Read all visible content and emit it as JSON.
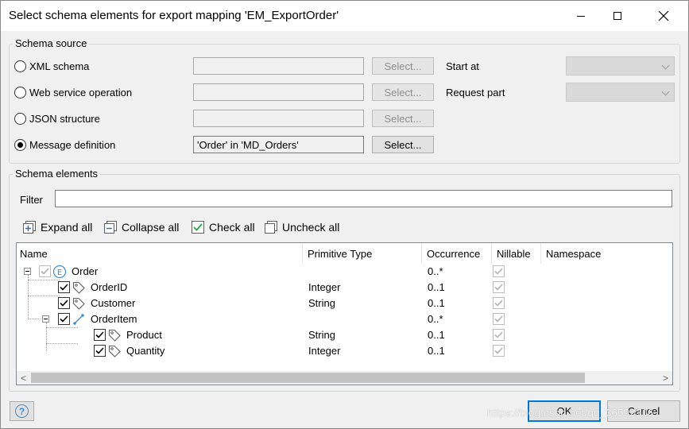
{
  "window": {
    "title": "Select schema elements for export mapping 'EM_ExportOrder'"
  },
  "schema_source": {
    "legend": "Schema source",
    "options": [
      {
        "label": "XML schema",
        "checked": false,
        "value": "",
        "button": "Select...",
        "button_enabled": false
      },
      {
        "label": "Web service operation",
        "checked": false,
        "value": "",
        "button": "Select...",
        "button_enabled": false
      },
      {
        "label": "JSON structure",
        "checked": false,
        "value": "",
        "button": "Select...",
        "button_enabled": false
      },
      {
        "label": "Message definition",
        "checked": true,
        "value": "'Order' in 'MD_Orders'",
        "button": "Select...",
        "button_enabled": true
      }
    ],
    "start_at_label": "Start at",
    "request_part_label": "Request part"
  },
  "schema_elements": {
    "legend": "Schema elements",
    "filter_label": "Filter",
    "filter_value": "",
    "toolbar": {
      "expand_all": "Expand all",
      "collapse_all": "Collapse all",
      "check_all": "Check all",
      "uncheck_all": "Uncheck all"
    },
    "columns": [
      "Name",
      "Primitive Type",
      "Occurrence",
      "Nillable",
      "Namespace"
    ],
    "rows": [
      {
        "name": "Order",
        "type": "",
        "occurrence": "0..*",
        "nillable": true,
        "level": 0,
        "icon": "element-icon",
        "expandable": true,
        "checked": true,
        "disabled": true
      },
      {
        "name": "OrderID",
        "type": "Integer",
        "occurrence": "0..1",
        "nillable": true,
        "level": 1,
        "icon": "attribute-tag-icon",
        "expandable": false,
        "checked": true,
        "disabled": false
      },
      {
        "name": "Customer",
        "type": "String",
        "occurrence": "0..1",
        "nillable": true,
        "level": 1,
        "icon": "attribute-tag-icon",
        "expandable": false,
        "checked": true,
        "disabled": false
      },
      {
        "name": "OrderItem",
        "type": "",
        "occurrence": "0..*",
        "nillable": true,
        "level": 1,
        "icon": "association-icon",
        "expandable": true,
        "checked": true,
        "disabled": false
      },
      {
        "name": "Product",
        "type": "String",
        "occurrence": "0..1",
        "nillable": true,
        "level": 2,
        "icon": "attribute-tag-icon",
        "expandable": false,
        "checked": true,
        "disabled": false
      },
      {
        "name": "Quantity",
        "type": "Integer",
        "occurrence": "0..1",
        "nillable": true,
        "level": 2,
        "icon": "attribute-tag-icon",
        "expandable": false,
        "checked": true,
        "disabled": false
      }
    ]
  },
  "buttons": {
    "ok": "OK",
    "cancel": "Cancel",
    "help": "?"
  },
  "watermark": "https://blog.csdn.net/qq_36592316",
  "colors": {
    "accent": "#0078d7",
    "element_icon": "#3a8fd6",
    "association_icon": "#3a8fd6"
  }
}
